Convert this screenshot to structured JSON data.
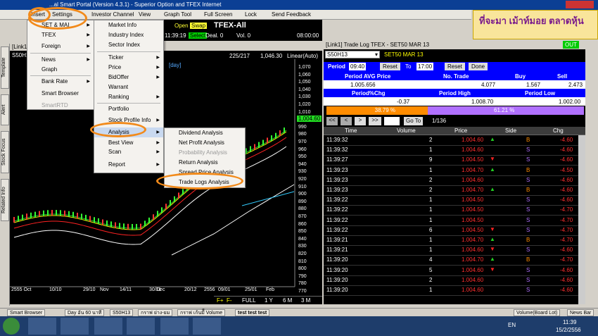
{
  "title": "...al Smart Portal (Version 4.3.1) - Superior Option and TFEX Internet",
  "menu": {
    "insert": "Insert",
    "settings": "Settings",
    "investor": "Investor Channel",
    "view": "View",
    "graph_tool": "Graph Tool",
    "full_screen": "Full Screen",
    "lock": "Lock",
    "send_feedback": "Send Feedback"
  },
  "insert_menu": {
    "set_mai": "SET & MAI",
    "tfex": "TFEX",
    "foreign": "Foreign",
    "news": "News",
    "graph": "Graph",
    "bank_rate": "Bank Rate",
    "smart_browser": "Smart Browser",
    "smart_rtd": "SmartRTD"
  },
  "sub_menu": {
    "market_info": "Market Info",
    "industry_index": "Industry Index",
    "sector_index": "Sector Index",
    "ticker": "Ticker",
    "price": "Price",
    "bid_offer": "BidOffer",
    "warrant": "Warrant",
    "ranking": "Ranking",
    "portfolio": "Portfolio",
    "stock_profile": "Stock Profile Info",
    "analysis": "Analysis",
    "best_view": "Best View",
    "scan": "Scan",
    "report": "Report"
  },
  "analysis_menu": {
    "dividend": "Dividend Analysis",
    "net_profit": "Net Profit Analysis",
    "probability": "Probability Analysis",
    "return": "Return Analysis",
    "spread_price": "Spread Price Analysis",
    "trade_logs": "Trade Logs Analysis"
  },
  "ticker_bar": {
    "open": "Open",
    "swap": "Swap",
    "name": "TFEX-All",
    "time": "11:39:19",
    "select": "Select",
    "deal": "Deal. 0",
    "vol": "Vol. 0",
    "clock": "08:00:00"
  },
  "banner": {
    "text": "ที่จะมา เม้าท์มอย ตลาดหุ้น"
  },
  "side_tabs": [
    "Template",
    "Alert",
    "Stock Focus",
    "Related Info"
  ],
  "chart": {
    "header": "[Link1]",
    "symbol": "S50H13",
    "day": "[day]",
    "count": "225/217",
    "value": "1,046.30",
    "scale": "Linear(Auto)",
    "last": "1,004.60",
    "y_ticks": [
      "1,070",
      "1,060",
      "1,050",
      "1,040",
      "1,030",
      "1,020",
      "1,010",
      "1,000",
      "990",
      "980",
      "970",
      "960",
      "950",
      "940",
      "930",
      "920",
      "910",
      "900",
      "890",
      "880",
      "870",
      "860",
      "850",
      "840",
      "830",
      "820",
      "810",
      "800",
      "790",
      "780",
      "770"
    ],
    "x_dates": [
      "2555 Oct",
      "10/10",
      "29/10",
      "Nov",
      "14/11",
      "30/11",
      "Dec",
      "20/12",
      "2556",
      "09/01",
      "25/01",
      "Feb"
    ],
    "period_btns": [
      "FULL",
      "1 Y",
      "6 M",
      "3 M"
    ]
  },
  "tradelog": {
    "title": "[Link1] Trade Log TFEX - SET50 MAR 13",
    "out": "OUT",
    "symbol": "S50H13",
    "symbol_desc": "SET50 MAR 13",
    "period_label": "Period",
    "from": "09:40",
    "to_label": "To",
    "to": "17:00",
    "reset": "Reset",
    "done": "Done",
    "h1": [
      "Period AVG Price",
      "No. Trade",
      "Buy",
      "Sell"
    ],
    "v1": [
      "1.005.656",
      "4.077",
      "1.567",
      "2.473"
    ],
    "h2": [
      "Period%Chg",
      "Period High",
      "Period Low"
    ],
    "v2": [
      "-0.37",
      "1.008.70",
      "1.002.00"
    ],
    "pct_buy": "38.79 %",
    "pct_sell": "61.21 %",
    "goto": "Go To",
    "page": "1/136",
    "cols": [
      "Time",
      "Volume",
      "Price",
      "Side",
      "Chg"
    ],
    "rows": [
      [
        "11:39:32",
        "2",
        "1.004.60",
        "up",
        "B",
        "-4.60"
      ],
      [
        "11:39:32",
        "1",
        "1.004.60",
        "",
        "S",
        "-4.60"
      ],
      [
        "11:39:27",
        "9",
        "1.004.50",
        "down",
        "S",
        "-4.60"
      ],
      [
        "11:39:23",
        "1",
        "1.004.70",
        "up",
        "B",
        "-4.50"
      ],
      [
        "11:39:23",
        "2",
        "1.004.60",
        "",
        "S",
        "-4.60"
      ],
      [
        "11:39:23",
        "2",
        "1.004.70",
        "up",
        "B",
        "-4.60"
      ],
      [
        "11:39:22",
        "1",
        "1.004.50",
        "",
        "S",
        "-4.60"
      ],
      [
        "11:39:22",
        "1",
        "1.004.50",
        "",
        "S",
        "-4.70"
      ],
      [
        "11:39:22",
        "1",
        "1.004.50",
        "",
        "S",
        "-4.70"
      ],
      [
        "11:39:22",
        "6",
        "1.004.50",
        "down",
        "S",
        "-4.70"
      ],
      [
        "11:39:21",
        "1",
        "1.004.70",
        "up",
        "B",
        "-4.70"
      ],
      [
        "11:39:21",
        "1",
        "1.004.60",
        "down",
        "S",
        "-4.60"
      ],
      [
        "11:39:20",
        "4",
        "1.004.70",
        "up",
        "B",
        "-4.70"
      ],
      [
        "11:39:20",
        "5",
        "1.004.60",
        "down",
        "S",
        "-4.60"
      ],
      [
        "11:39:20",
        "2",
        "1.004.60",
        "",
        "S",
        "-4.60"
      ],
      [
        "11:39:20",
        "1",
        "1.004.60",
        "",
        "S",
        "-4.60"
      ]
    ]
  },
  "bottom": {
    "tabs": [
      "Smart Browser",
      "Day อัน 60 นาที",
      "S50H13",
      "กราฟ ย่าง-ยม",
      "กราฟ เก้นมีี Volume",
      "test test test"
    ],
    "volume": "Volume(Board Lot)",
    "news": "News Bar"
  },
  "taskbar": {
    "lang": "EN",
    "time": "11:39",
    "date": "15/2/2556"
  }
}
